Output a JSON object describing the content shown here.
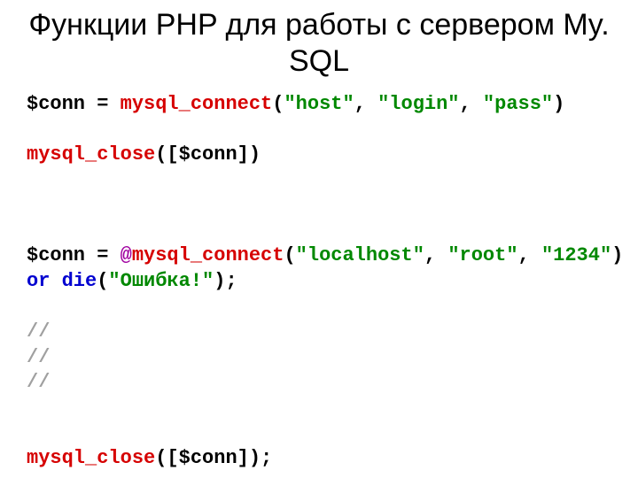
{
  "title": "Функции PHP для работы с сервером My. SQL",
  "code": {
    "l1": {
      "a": "$conn = ",
      "b": "mysql_connect",
      "c": "(",
      "d": "\"host\"",
      "e": ", ",
      "f": "\"login\"",
      "g": ", ",
      "h": "\"pass\"",
      "i": ")"
    },
    "l2": {
      "a": "mysql_close",
      "b": "([$conn])"
    },
    "l3": {
      "a": "$conn = ",
      "b": "@",
      "c": "mysql_connect",
      "d": "(",
      "e": "\"localhost\"",
      "f": ", ",
      "g": "\"root\"",
      "h": ", ",
      "i": "\"1234\"",
      "j": ")"
    },
    "l4": {
      "a": "or",
      "b": " ",
      "c": "die",
      "d": "(",
      "e": "\"Ошибка!\"",
      "f": ");"
    },
    "c1": "//",
    "c2": "//",
    "c3": "//",
    "l5": {
      "a": "mysql_close",
      "b": "([$conn]);"
    }
  }
}
